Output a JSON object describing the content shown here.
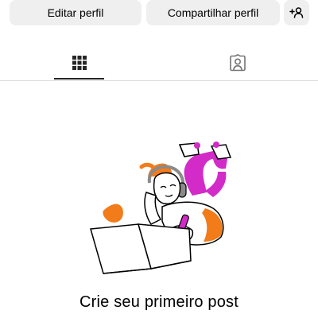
{
  "actions": {
    "edit_profile_label": "Editar perfil",
    "share_profile_label": "Compartilhar perfil",
    "add_person_icon": "add-person-icon"
  },
  "tabs": [
    {
      "name": "posts-grid",
      "icon": "grid-icon",
      "selected": true
    },
    {
      "name": "tagged",
      "icon": "tagged-person-icon",
      "selected": false
    }
  ],
  "empty_state": {
    "illustration": "person-with-laptop-illustration",
    "title": "Crie seu primeiro post"
  },
  "colors": {
    "button_bg": "#efefef",
    "divider": "#dbdbdb",
    "indicator": "#262626",
    "orange": "#f27b1a",
    "magenta": "#d22bc8"
  }
}
